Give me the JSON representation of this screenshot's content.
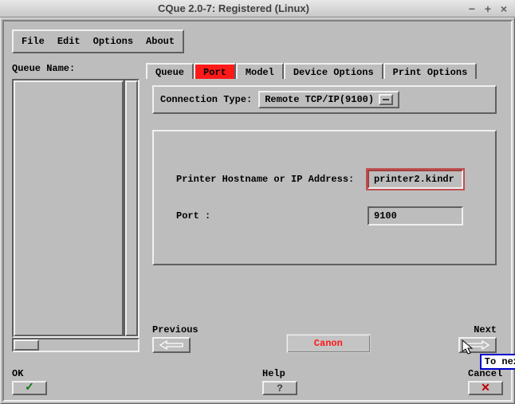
{
  "window": {
    "title": "CQue 2.0-7: Registered (Linux)"
  },
  "menu": {
    "file": "File",
    "edit": "Edit",
    "options": "Options",
    "about": "About"
  },
  "sidebar": {
    "label": "Queue Name:"
  },
  "tabs": {
    "queue": "Queue",
    "port": "Port",
    "model": "Model",
    "device": "Device Options",
    "print": "Print Options"
  },
  "connection": {
    "label": "Connection Type:",
    "value": "Remote TCP/IP(9100)"
  },
  "form": {
    "host_label": "Printer Hostname or IP Address:",
    "host_value": "printer2.kindr",
    "port_label": "Port :",
    "port_value": "9100"
  },
  "nav": {
    "prev": "Previous",
    "next": "Next",
    "brand": "Canon",
    "tooltip": "To nex"
  },
  "bottom": {
    "ok": "OK",
    "help": "Help",
    "cancel": "Cancel"
  }
}
